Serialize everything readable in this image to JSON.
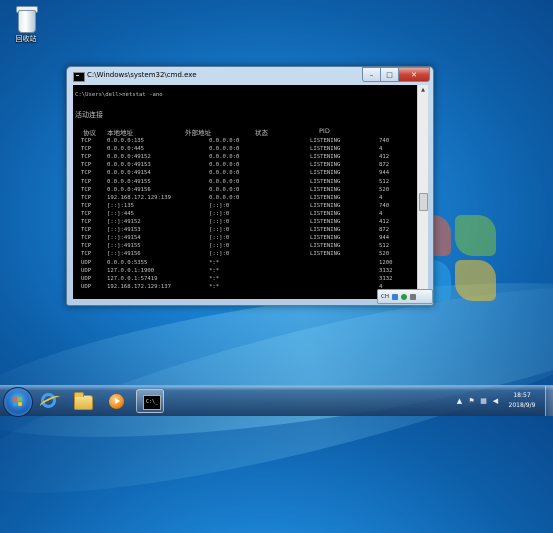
{
  "desktop": {
    "icons": [
      {
        "label": "回收站",
        "icon": "recycle-bin-icon"
      }
    ]
  },
  "window": {
    "title": "C:\\Windows\\system32\\cmd.exe",
    "controls": {
      "minimize": "–",
      "maximize": "□",
      "close": "✕"
    },
    "console": {
      "prompt": "C:\\Users\\dell>netstat -ano",
      "section_title": "活动连接",
      "headers": {
        "proto": "协议",
        "local": "本地地址",
        "foreign": "外部地址",
        "state": "状态",
        "pid": "PID"
      },
      "rows": [
        {
          "proto": "TCP",
          "local": "0.0.0.0:135",
          "foreign": "0.0.0.0:0",
          "state": "LISTENING",
          "pid": "740"
        },
        {
          "proto": "TCP",
          "local": "0.0.0.0:445",
          "foreign": "0.0.0.0:0",
          "state": "LISTENING",
          "pid": "4"
        },
        {
          "proto": "TCP",
          "local": "0.0.0.0:49152",
          "foreign": "0.0.0.0:0",
          "state": "LISTENING",
          "pid": "412"
        },
        {
          "proto": "TCP",
          "local": "0.0.0.0:49153",
          "foreign": "0.0.0.0:0",
          "state": "LISTENING",
          "pid": "872"
        },
        {
          "proto": "TCP",
          "local": "0.0.0.0:49154",
          "foreign": "0.0.0.0:0",
          "state": "LISTENING",
          "pid": "944"
        },
        {
          "proto": "TCP",
          "local": "0.0.0.0:49155",
          "foreign": "0.0.0.0:0",
          "state": "LISTENING",
          "pid": "512"
        },
        {
          "proto": "TCP",
          "local": "0.0.0.0:49156",
          "foreign": "0.0.0.0:0",
          "state": "LISTENING",
          "pid": "520"
        },
        {
          "proto": "TCP",
          "local": "192.168.172.129:139",
          "foreign": "0.0.0.0:0",
          "state": "LISTENING",
          "pid": "4"
        },
        {
          "proto": "TCP",
          "local": "[::]:135",
          "foreign": "[::]:0",
          "state": "LISTENING",
          "pid": "740"
        },
        {
          "proto": "TCP",
          "local": "[::]:445",
          "foreign": "[::]:0",
          "state": "LISTENING",
          "pid": "4"
        },
        {
          "proto": "TCP",
          "local": "[::]:49152",
          "foreign": "[::]:0",
          "state": "LISTENING",
          "pid": "412"
        },
        {
          "proto": "TCP",
          "local": "[::]:49153",
          "foreign": "[::]:0",
          "state": "LISTENING",
          "pid": "872"
        },
        {
          "proto": "TCP",
          "local": "[::]:49154",
          "foreign": "[::]:0",
          "state": "LISTENING",
          "pid": "944"
        },
        {
          "proto": "TCP",
          "local": "[::]:49155",
          "foreign": "[::]:0",
          "state": "LISTENING",
          "pid": "512"
        },
        {
          "proto": "TCP",
          "local": "[::]:49156",
          "foreign": "[::]:0",
          "state": "LISTENING",
          "pid": "520"
        },
        {
          "proto": "UDP",
          "local": "0.0.0.0:5355",
          "foreign": "*:*",
          "state": "",
          "pid": "1200"
        },
        {
          "proto": "UDP",
          "local": "127.0.0.1:1900",
          "foreign": "*:*",
          "state": "",
          "pid": "3132"
        },
        {
          "proto": "UDP",
          "local": "127.0.0.1:57419",
          "foreign": "*:*",
          "state": "",
          "pid": "3132"
        },
        {
          "proto": "UDP",
          "local": "192.168.172.129:137",
          "foreign": "*:*",
          "state": "",
          "pid": "4"
        }
      ]
    }
  },
  "language_bar": {
    "label": "CH",
    "icons": [
      "language-icon",
      "help-icon",
      "keyboard-icon"
    ]
  },
  "taskbar": {
    "pinned": [
      {
        "name": "internet-explorer",
        "icon": "ie-icon"
      },
      {
        "name": "windows-explorer",
        "icon": "folder-icon"
      },
      {
        "name": "media-player",
        "icon": "media-player-icon"
      },
      {
        "name": "command-prompt",
        "icon": "cmd-icon",
        "glyph": "C:\\_",
        "active": true
      }
    ],
    "tray": {
      "icons": [
        "up-arrow-icon",
        "flag-icon",
        "network-icon",
        "volume-icon"
      ],
      "time": "18:57",
      "date": "2018/9/9"
    }
  }
}
